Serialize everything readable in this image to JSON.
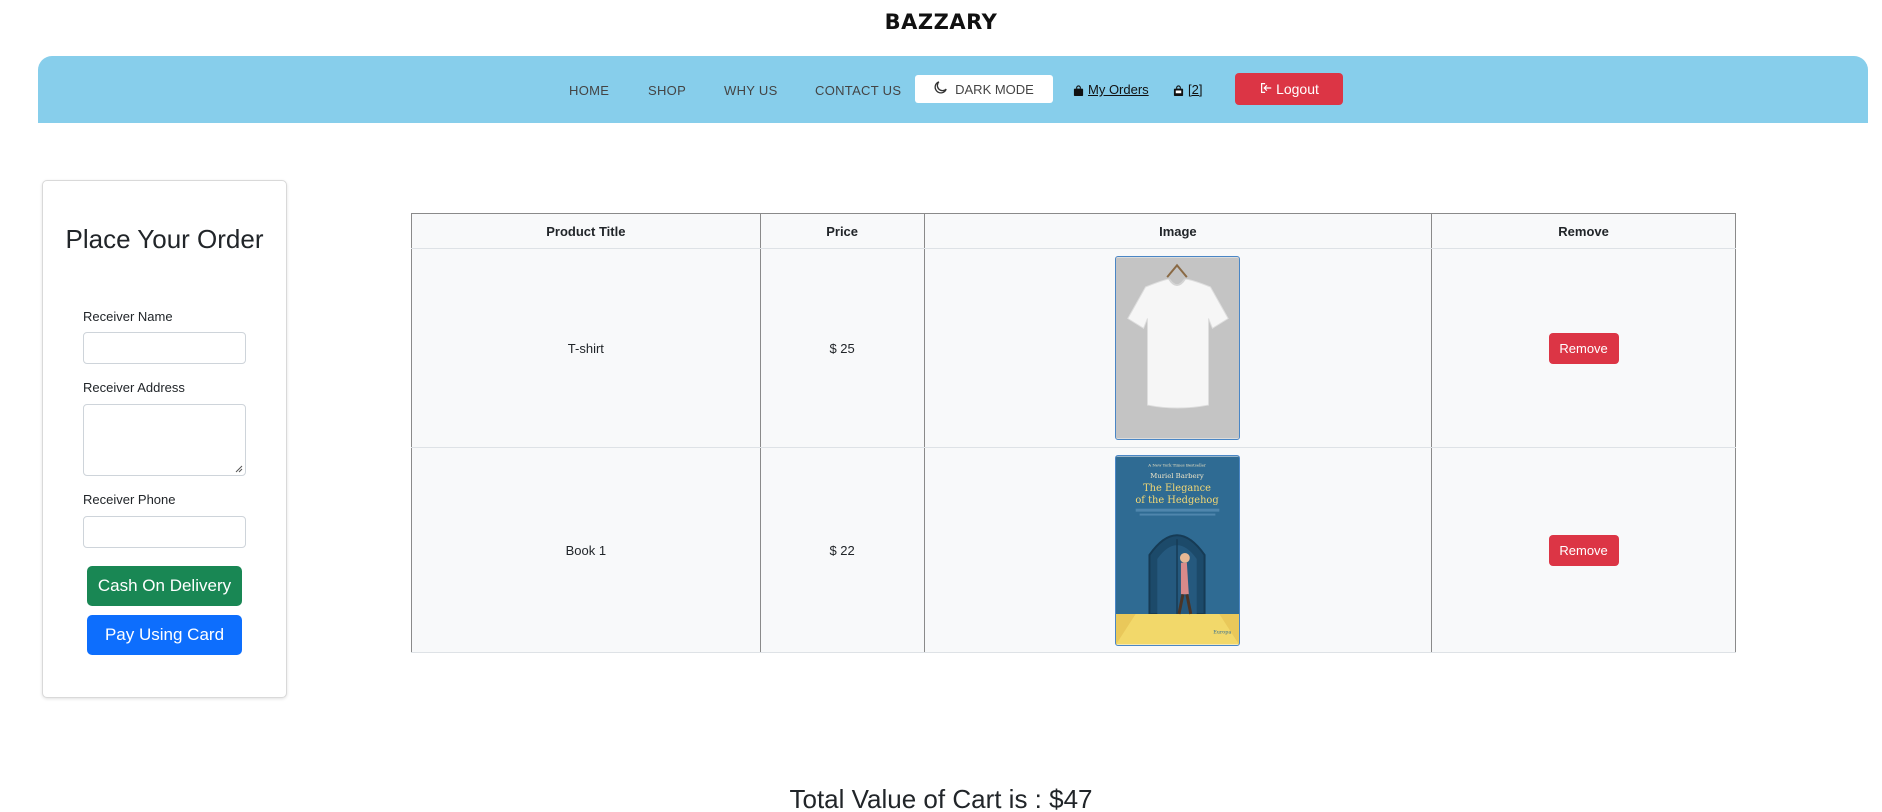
{
  "brand": "BAZZARY",
  "nav": {
    "home": "HOME",
    "shop": "SHOP",
    "why_us": "WHY US",
    "contact_us": "CONTACT US",
    "dark_mode": "DARK MODE",
    "my_orders": "My Orders",
    "cart_count": "[2]",
    "logout": "Logout",
    "bg_color": "#87ceeb"
  },
  "order_form": {
    "title": "Place Your Order",
    "receiver_name_label": "Receiver Name",
    "receiver_name_value": "",
    "receiver_address_label": "Receiver Address",
    "receiver_address_value": "",
    "receiver_phone_label": "Receiver Phone",
    "receiver_phone_value": "",
    "cod_button": "Cash On Delivery",
    "card_button": "Pay Using Card"
  },
  "cart_table": {
    "headers": [
      "Product Title",
      "Price",
      "Image",
      "Remove"
    ],
    "rows": [
      {
        "title": "T-shirt",
        "price": "$ 25",
        "image": "white-tshirt-image",
        "remove": "Remove"
      },
      {
        "title": "Book 1",
        "price": "$ 22",
        "image": "book-cover-image",
        "remove": "Remove"
      }
    ],
    "book_cover": {
      "top_line": "A New York Times Bestseller",
      "author": "Muriel Barbery",
      "title_line1": "The Elegance",
      "title_line2": "of the Hedgehog",
      "publisher": "Europa"
    }
  },
  "total_label": "Total Value of Cart is : $47",
  "colors": {
    "danger": "#dc3545",
    "success": "#198754",
    "primary": "#0d6efd"
  }
}
